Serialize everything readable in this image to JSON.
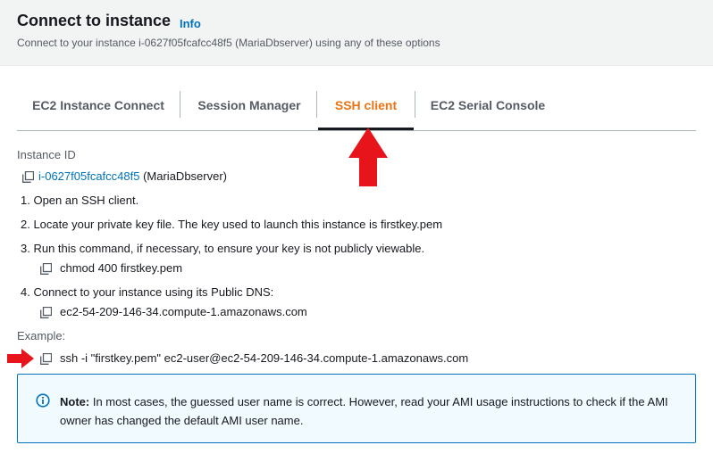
{
  "header": {
    "title": "Connect to instance",
    "info_label": "Info",
    "subtitle": "Connect to your instance i-0627f05fcafcc48f5 (MariaDbserver) using any of these options"
  },
  "tabs": [
    {
      "label": "EC2 Instance Connect",
      "active": false
    },
    {
      "label": "Session Manager",
      "active": false
    },
    {
      "label": "SSH client",
      "active": true
    },
    {
      "label": "EC2 Serial Console",
      "active": false
    }
  ],
  "instance": {
    "label": "Instance ID",
    "id": "i-0627f05fcafcc48f5",
    "name": "(MariaDbserver)"
  },
  "steps": [
    "1. Open an SSH client.",
    "2. Locate your private key file. The key used to launch this instance is firstkey.pem",
    "3. Run this command, if necessary, to ensure your key is not publicly viewable.",
    "4. Connect to your instance using its Public DNS:"
  ],
  "commands": {
    "chmod": "chmod 400 firstkey.pem",
    "public_dns": "ec2-54-209-146-34.compute-1.amazonaws.com",
    "example_label": "Example:",
    "ssh": "ssh -i \"firstkey.pem\" ec2-user@ec2-54-209-146-34.compute-1.amazonaws.com"
  },
  "note": {
    "bold": "Note:",
    "text": " In most cases, the guessed user name is correct. However, read your AMI usage instructions to check if the AMI owner has changed the default AMI user name."
  },
  "colors": {
    "accent_orange": "#ec7211",
    "link_blue": "#0073bb",
    "annotation_red": "#e8141b"
  }
}
